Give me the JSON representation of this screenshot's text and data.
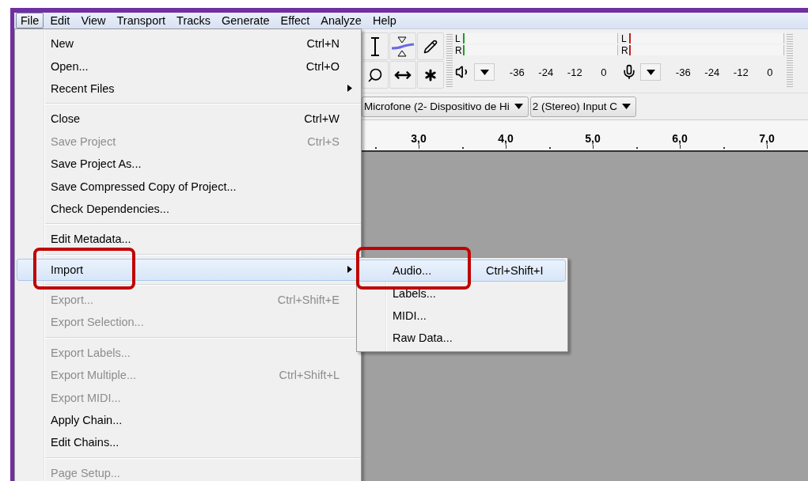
{
  "menubar": [
    {
      "label": "File",
      "selected": true
    },
    {
      "label": "Edit",
      "selected": false
    },
    {
      "label": "View",
      "selected": false
    },
    {
      "label": "Transport",
      "selected": false
    },
    {
      "label": "Tracks",
      "selected": false
    },
    {
      "label": "Generate",
      "selected": false
    },
    {
      "label": "Effect",
      "selected": false
    },
    {
      "label": "Analyze",
      "selected": false
    },
    {
      "label": "Help",
      "selected": false
    }
  ],
  "meters": [
    {
      "kind": "playback",
      "channels": [
        "L",
        "R"
      ],
      "scale": [
        "-36",
        "-24",
        "-12",
        "0"
      ]
    },
    {
      "kind": "recording",
      "channels": [
        "L",
        "R"
      ],
      "scale": [
        "-36",
        "-24",
        "-12",
        "0"
      ]
    }
  ],
  "devices": [
    {
      "value": "Microfone (2- Dispositivo de Hi"
    },
    {
      "value": "2 (Stereo) Input C"
    }
  ],
  "ruler": [
    "3,0",
    "4,0",
    "5,0",
    "6,0",
    "7,0"
  ],
  "file_menu": [
    {
      "kind": "item",
      "label": "New",
      "shortcut": "Ctrl+N",
      "disabled": false,
      "submenu": false,
      "selected": false
    },
    {
      "kind": "item",
      "label": "Open...",
      "shortcut": "Ctrl+O",
      "disabled": false,
      "submenu": false,
      "selected": false
    },
    {
      "kind": "item",
      "label": "Recent Files",
      "disabled": false,
      "submenu": true,
      "selected": false
    },
    {
      "kind": "separator"
    },
    {
      "kind": "item",
      "label": "Close",
      "shortcut": "Ctrl+W",
      "disabled": false,
      "submenu": false,
      "selected": false
    },
    {
      "kind": "item",
      "label": "Save Project",
      "shortcut": "Ctrl+S",
      "disabled": true,
      "submenu": false,
      "selected": false
    },
    {
      "kind": "item",
      "label": "Save Project As...",
      "disabled": false,
      "submenu": false,
      "selected": false
    },
    {
      "kind": "item",
      "label": "Save Compressed Copy of Project...",
      "disabled": false,
      "submenu": false,
      "selected": false
    },
    {
      "kind": "item",
      "label": "Check Dependencies...",
      "disabled": false,
      "submenu": false,
      "selected": false
    },
    {
      "kind": "separator"
    },
    {
      "kind": "item",
      "label": "Edit Metadata...",
      "disabled": false,
      "submenu": false,
      "selected": false
    },
    {
      "kind": "separator"
    },
    {
      "kind": "item",
      "label": "Import",
      "disabled": false,
      "submenu": true,
      "selected": true
    },
    {
      "kind": "separator"
    },
    {
      "kind": "item",
      "label": "Export...",
      "shortcut": "Ctrl+Shift+E",
      "disabled": true,
      "submenu": false,
      "selected": false
    },
    {
      "kind": "item",
      "label": "Export Selection...",
      "disabled": true,
      "submenu": false,
      "selected": false
    },
    {
      "kind": "separator"
    },
    {
      "kind": "item",
      "label": "Export Labels...",
      "disabled": true,
      "submenu": false,
      "selected": false
    },
    {
      "kind": "item",
      "label": "Export Multiple...",
      "shortcut": "Ctrl+Shift+L",
      "disabled": true,
      "submenu": false,
      "selected": false
    },
    {
      "kind": "item",
      "label": "Export MIDI...",
      "disabled": true,
      "submenu": false,
      "selected": false
    },
    {
      "kind": "item",
      "label": "Apply Chain...",
      "disabled": false,
      "submenu": false,
      "selected": false
    },
    {
      "kind": "item",
      "label": "Edit Chains...",
      "disabled": false,
      "submenu": false,
      "selected": false
    },
    {
      "kind": "separator"
    },
    {
      "kind": "item",
      "label": "Page Setup...",
      "disabled": true,
      "submenu": false,
      "selected": false
    }
  ],
  "import_submenu": [
    {
      "label": "Audio...",
      "shortcut": "Ctrl+Shift+I",
      "selected": true
    },
    {
      "label": "Labels...",
      "selected": false
    },
    {
      "label": "MIDI...",
      "selected": false
    },
    {
      "label": "Raw Data...",
      "selected": false
    }
  ]
}
